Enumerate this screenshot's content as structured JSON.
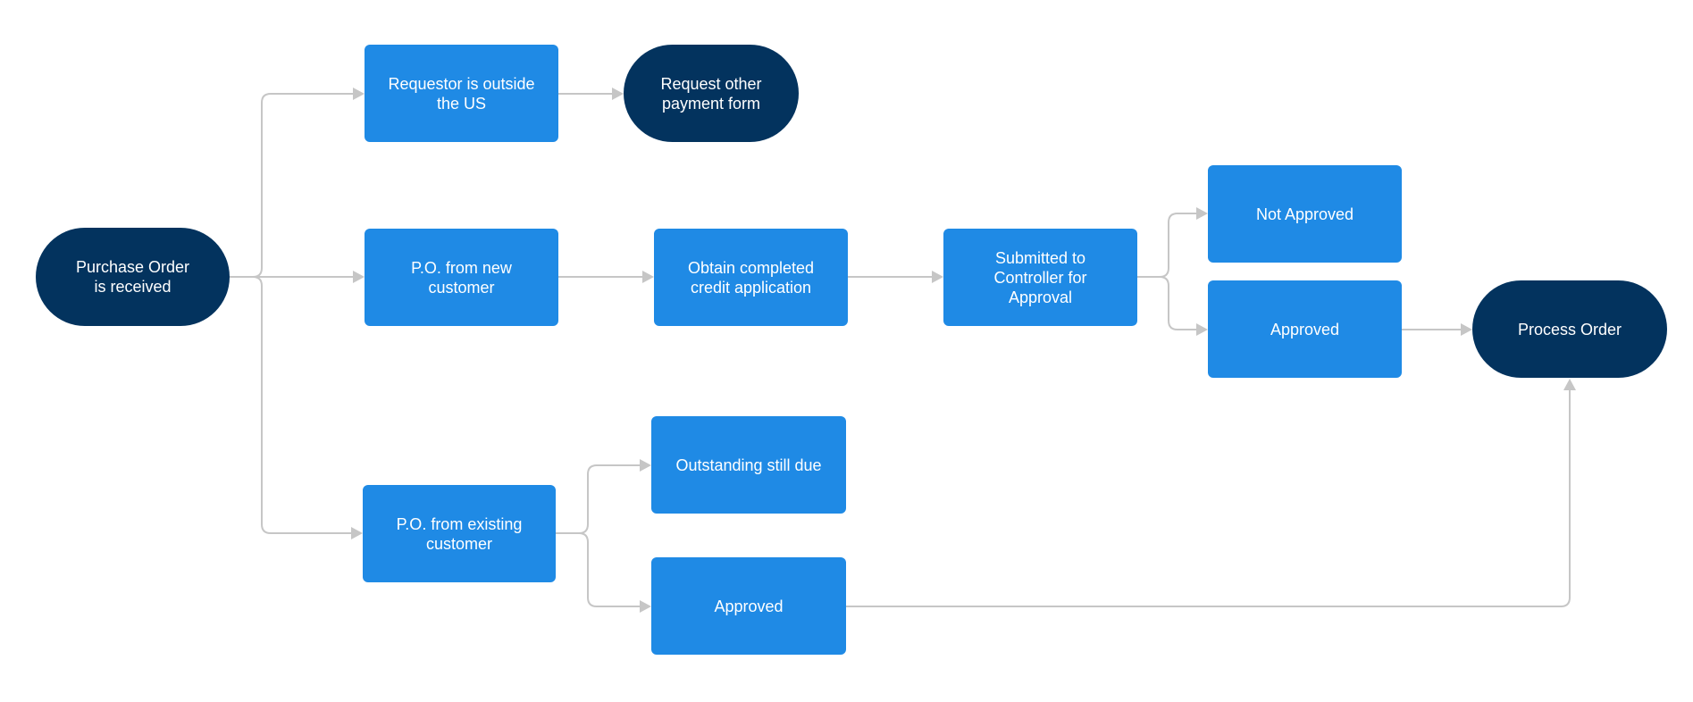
{
  "diagram": {
    "type": "flowchart",
    "colors": {
      "process": "#1f8ae5",
      "terminal": "#03335e",
      "connector": "#c6c6c6",
      "text": "#ffffff"
    },
    "nodes": [
      {
        "id": "po_received",
        "kind": "terminal",
        "label": "Purchase Order\nis received"
      },
      {
        "id": "requestor_outside",
        "kind": "process",
        "label": "Requestor is outside\nthe US"
      },
      {
        "id": "request_other_payment",
        "kind": "terminal",
        "label": "Request other\npayment form"
      },
      {
        "id": "po_new_customer",
        "kind": "process",
        "label": "P.O. from new\ncustomer"
      },
      {
        "id": "obtain_credit_app",
        "kind": "process",
        "label": "Obtain completed\ncredit application"
      },
      {
        "id": "submitted_controller",
        "kind": "process",
        "label": "Submitted to\nController for\nApproval"
      },
      {
        "id": "not_approved",
        "kind": "process",
        "label": "Not Approved"
      },
      {
        "id": "approved_new",
        "kind": "process",
        "label": "Approved"
      },
      {
        "id": "process_order",
        "kind": "terminal",
        "label": "Process Order"
      },
      {
        "id": "po_existing_customer",
        "kind": "process",
        "label": "P.O. from existing\ncustomer"
      },
      {
        "id": "outstanding_due",
        "kind": "process",
        "label": "Outstanding still due"
      },
      {
        "id": "approved_existing",
        "kind": "process",
        "label": "Approved"
      }
    ],
    "edges": [
      {
        "from": "po_received",
        "to": "requestor_outside"
      },
      {
        "from": "po_received",
        "to": "po_new_customer"
      },
      {
        "from": "po_received",
        "to": "po_existing_customer"
      },
      {
        "from": "requestor_outside",
        "to": "request_other_payment"
      },
      {
        "from": "po_new_customer",
        "to": "obtain_credit_app"
      },
      {
        "from": "obtain_credit_app",
        "to": "submitted_controller"
      },
      {
        "from": "submitted_controller",
        "to": "not_approved"
      },
      {
        "from": "submitted_controller",
        "to": "approved_new"
      },
      {
        "from": "approved_new",
        "to": "process_order"
      },
      {
        "from": "po_existing_customer",
        "to": "outstanding_due"
      },
      {
        "from": "po_existing_customer",
        "to": "approved_existing"
      },
      {
        "from": "approved_existing",
        "to": "process_order"
      }
    ]
  }
}
